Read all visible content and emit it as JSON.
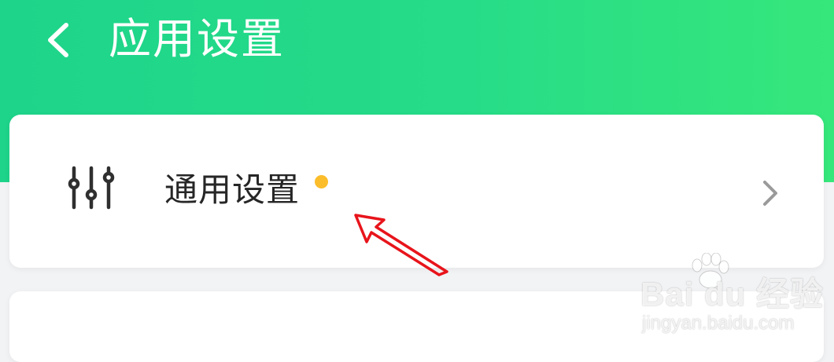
{
  "header": {
    "title": "应用设置",
    "back_icon": "chevron-left-icon",
    "gradient_colors": [
      "#1ed48a",
      "#36e77b"
    ]
  },
  "settings_items": [
    {
      "icon": "sliders-icon",
      "label": "通用设置",
      "has_badge_dot": true,
      "badge_color": "#fbbd2a",
      "trailing_icon": "chevron-right-icon"
    }
  ],
  "annotation": {
    "arrow_color": "#e8141b"
  },
  "watermark": {
    "brand": "Bai du",
    "suffix": "经验",
    "url": "jingyan.baidu.com"
  }
}
